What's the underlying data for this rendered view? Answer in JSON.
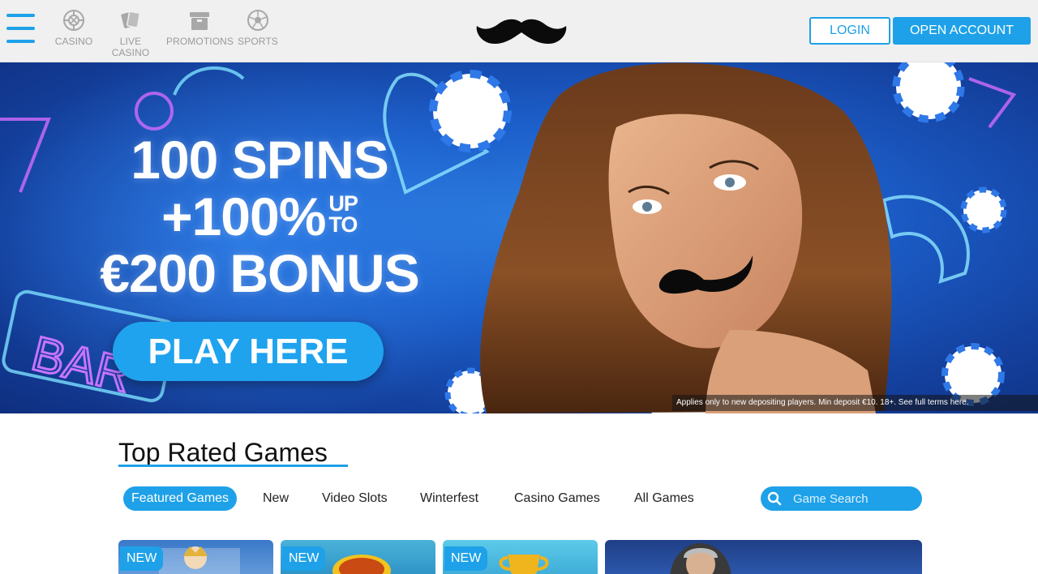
{
  "header": {
    "nav": [
      {
        "label": "CASINO",
        "icon": "roulette-icon"
      },
      {
        "label": "LIVE CASINO",
        "icon": "cards-icon"
      },
      {
        "label": "PROMOTIONS",
        "icon": "gift-box-icon"
      },
      {
        "label": "SPORTS",
        "icon": "soccer-ball-icon"
      }
    ],
    "logo_icon": "mustache-logo-icon",
    "login_label": "LOGIN",
    "open_account_label": "OPEN ACCOUNT"
  },
  "hero": {
    "line1": "100 SPINS",
    "line2": "+100%",
    "line2_up": "UP",
    "line2_to": "TO",
    "line3": "€200 BONUS",
    "cta_label": "PLAY HERE",
    "terms": "Applies only to new depositing players. Min deposit €10. 18+. See full terms here."
  },
  "games": {
    "title": "Top Rated Games",
    "tabs": [
      "Featured Games",
      "New",
      "Video Slots",
      "Winterfest",
      "Casino Games",
      "All Games"
    ],
    "active_tab": "Featured Games",
    "search_placeholder": "Game Search",
    "tile_badges": [
      "NEW",
      "NEW",
      "NEW"
    ]
  },
  "colors": {
    "accent": "#1ea1e8",
    "header_bg": "#f0f0f0",
    "hero_bg": "#1c5fcb"
  }
}
